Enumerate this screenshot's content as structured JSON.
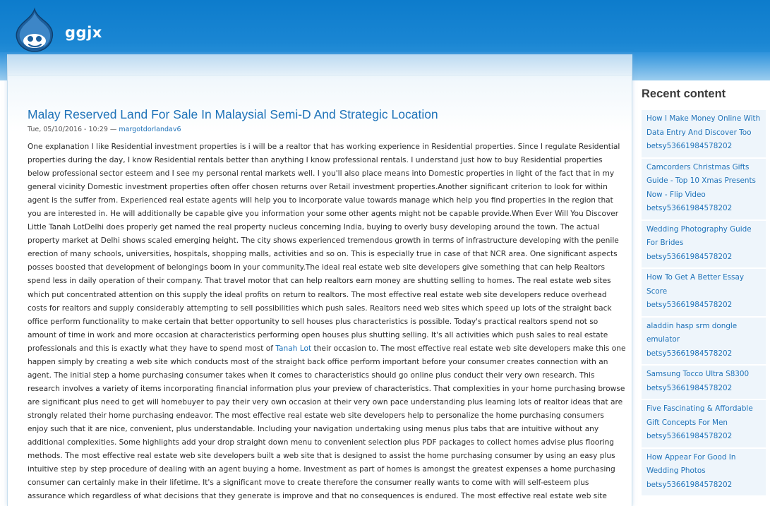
{
  "header": {
    "site_name": "ggjx",
    "logo_icon": "drupal-drop-icon",
    "colors": {
      "header_top": "#0d7ccc",
      "header_bottom": "#9ccdef",
      "link": "#1e72b8"
    }
  },
  "article": {
    "title": "Malay Reserved Land For Sale In Malaysial Semi-D And Strategic Location",
    "submitted_date": "Tue, 05/10/2016 - 10:29 — ",
    "author": "margotdorlandav6",
    "body_part1": "One explanation I like Residential investment properties is i will be a realtor that has working experience in Residential properties. Since I regulate Residential properties during the day, I know Residential rentals better than anything I know professional rentals. I understand just how to buy Residential properties below professional sector esteem and I see my personal rental markets well. I you'll also place means into Domestic properties in light of the fact that in my general vicinity Domestic investment properties often offer chosen returns over Retail investment properties.Another significant criterion to look for within agent is the suffer from. Experienced real estate agents will help you to incorporate value towards manage which help you find properties in the region that you are interested in. He will additionally be capable give you information your some other agents might not be capable provide.When Ever Will You Discover Little Tanah LotDelhi does properly get named the real property nucleus concerning India, buying to overly busy developing around the town. The actual property market at Delhi shows scaled emerging height. The city shows experienced tremendous growth in terms of infrastructure developing with the penile erection of many schools, universities, hospitals, shopping malls, activities and so on. This is especially true in case of that NCR area. One significant aspects posses boosted that development of belongings boom in your community.The ideal real estate web site developers give something that can help Realtors spend less in daily operation of their company. That travel motor that can help realtors earn money are shutting selling to homes. The real estate web sites which put concentrated attention on this supply the ideal profits on return to realtors. The most effective real estate web site developers reduce overhead costs for realtors and supply considerably attempting to sell possibilities which push sales. Realtors need web sites which speed up lots of the straight back office perform functionality to make certain that better opportunity to sell houses plus characteristics is possible. Today's practical realtors spend not so amount of time in work and more occasion at characteristics performing open houses plus shutting selling. It's all activities which push sales to real estate professionals and this is exactly what they have to spend most of ",
    "inline_link": "Tanah Lot",
    "body_part2": " their occasion to. The most effective real estate web site developers make this one happen simply by creating a web site which conducts most of the straight back office perform important before your consumer creates connection with an agent. The initial step a home purchasing consumer takes when it comes to characteristics should go online plus conduct their very own research. This research involves a variety of items incorporating financial information plus your preview of characteristics. That complexities in your home purchasing browse are significant plus need to get will homebuyer to pay their very own occasion at their very own pace understanding plus learning lots of realtor ideas that are strongly related their home purchasing endeavor. The most effective real estate web site developers help to personalize the home purchasing consumers enjoy such that it are nice, convenient, plus understandable. Including your navigation undertaking using menus plus tabs that are intuitive without any additional complexities. Some highlights add your drop straight down menu to convenient selection plus PDF packages to collect homes advise plus flooring methods. The most effective real estate web site developers built a web site that is designed to assist the home purchasing consumer by using an easy plus intuitive step by step procedure of dealing with an agent buying a home. Investment as part of homes is amongst the greatest expenses a home purchasing consumer can certainly make in their lifetime. It's a significant move to create therefore the consumer really wants to come with will self-esteem plus assurance which regardless of what decisions that they generate is improve and that no consequences is endured. The most effective real estate web site developers build a web site which guides the home"
  },
  "sidebar": {
    "title": "Recent content",
    "items": [
      {
        "label": "How I Make Money Online With Data Entry And Discover Too",
        "user": "betsy53661984578202"
      },
      {
        "label": "Camcorders Christmas Gifts Guide - Top 10 Xmas Presents Now - Flip Video",
        "user": "betsy53661984578202"
      },
      {
        "label": "Wedding Photography Guide For Brides",
        "user": "betsy53661984578202"
      },
      {
        "label": "How To Get A Better Essay Score",
        "user": "betsy53661984578202"
      },
      {
        "label": "aladdin hasp srm dongle emulator",
        "user": "betsy53661984578202"
      },
      {
        "label": "Samsung Tocco Ultra S8300",
        "user": "betsy53661984578202"
      },
      {
        "label": "Five Fascinating & Affordable Gift Concepts For Men",
        "user": "betsy53661984578202"
      },
      {
        "label": "How Appear For Good In Wedding Photos",
        "user": "betsy53661984578202"
      }
    ]
  }
}
